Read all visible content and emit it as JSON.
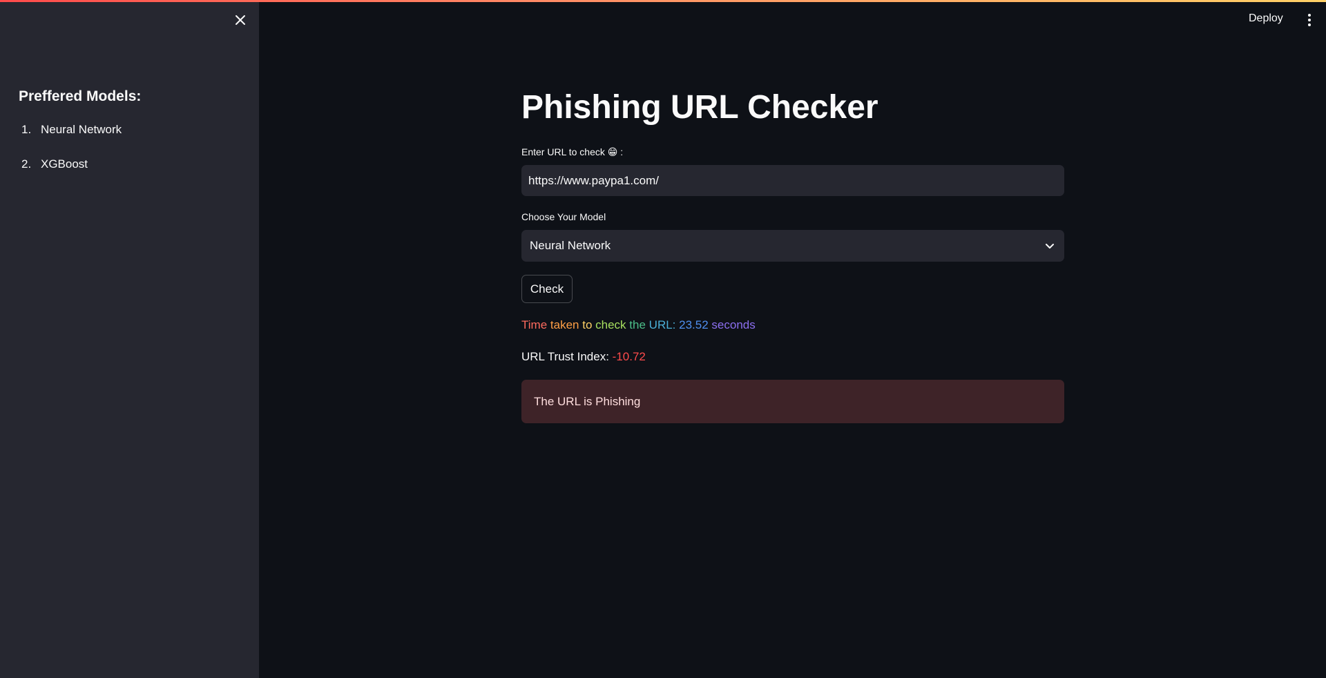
{
  "header": {
    "deploy_label": "Deploy",
    "menu_icon": "vertical-ellipsis-icon"
  },
  "sidebar": {
    "close_icon": "close-icon",
    "heading": "Preffered Models:",
    "items": [
      {
        "number": "1.",
        "label": "Neural Network"
      },
      {
        "number": "2.",
        "label": "XGBoost"
      }
    ]
  },
  "main": {
    "title": "Phishing URL Checker",
    "url_label": "Enter URL to check 😁 :",
    "url_value": "https://www.paypa1.com/",
    "model_label": "Choose Your Model",
    "model_selected": "Neural Network",
    "check_button_label": "Check",
    "time_taken": {
      "words": [
        "Time",
        "taken",
        "to",
        "check",
        "the",
        "URL:",
        "23.52",
        "seconds"
      ],
      "colors": [
        "#ff6b5e",
        "#ff9f45",
        "#ffd166",
        "#a8e05f",
        "#4cbf8a",
        "#4bb0d8",
        "#4f8ff0",
        "#8c6ff0"
      ]
    },
    "trust_label": "URL Trust Index:",
    "trust_value": "-10.72",
    "result_text": "The URL is Phishing"
  },
  "colors": {
    "app_background": "#0e1117",
    "sidebar_background": "#262730",
    "error_text": "#ff4b4b",
    "alert_background": "#3e2328"
  }
}
